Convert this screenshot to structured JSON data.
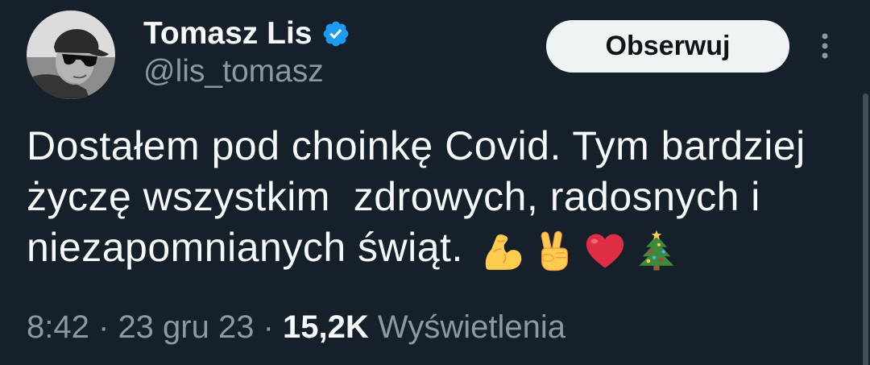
{
  "theme": {
    "background": "#15202b",
    "text": "#f7f9f9",
    "muted": "#8b98a5",
    "accent": "#1d9bf0",
    "button_background": "#eff3f4"
  },
  "author": {
    "name": "Tomasz Lis",
    "handle": "@lis_tomasz",
    "verified": true,
    "avatar_icon": "profile-photo-icon",
    "badge_icon": "verified-badge-icon"
  },
  "follow_button": {
    "label": "Obserwuj"
  },
  "more_menu": {
    "icon": "more-vertical-icon"
  },
  "tweet": {
    "lines": [
      "Dostałem pod choinkę Covid. Tym bardziej",
      "życzę wszystkim  zdrowych, radosnych i",
      "niezapomnianych świąt."
    ],
    "emojis": [
      "flexed-biceps-emoji-icon",
      "victory-hand-emoji-icon",
      "red-heart-emoji-icon",
      "christmas-tree-emoji-icon"
    ]
  },
  "meta": {
    "time": "8:42",
    "separator": "·",
    "date": "23 gru 23",
    "views_count": "15,2K",
    "views_label": "Wyświetlenia"
  }
}
